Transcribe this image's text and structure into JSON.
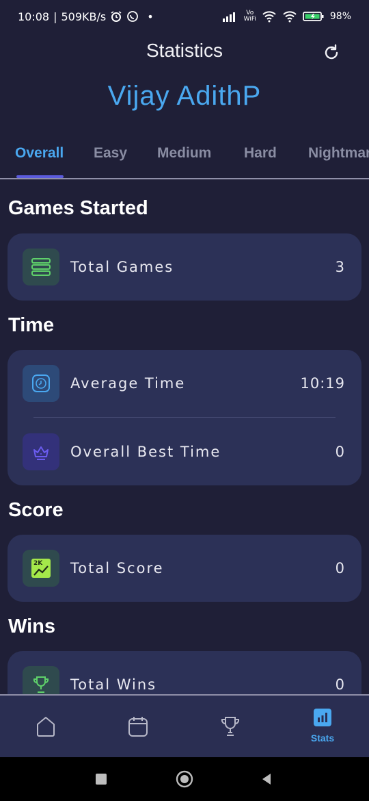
{
  "status_bar": {
    "time": "10:08",
    "network_speed": "509KB/s",
    "battery": "98%",
    "icons": [
      "alarm-icon",
      "whatsapp-icon",
      "signal-icon",
      "vowifi-icon",
      "wifi-icon",
      "battery-icon"
    ],
    "vowifi_top": "Vo",
    "vowifi_bottom": "WiFi"
  },
  "header": {
    "title": "Statistics",
    "refresh_icon": "refresh-icon"
  },
  "user": {
    "name": "Vijay AdithP"
  },
  "tabs": [
    {
      "label": "Overall",
      "active": true
    },
    {
      "label": "Easy",
      "active": false
    },
    {
      "label": "Medium",
      "active": false
    },
    {
      "label": "Hard",
      "active": false
    },
    {
      "label": "Nightmar",
      "active": false
    }
  ],
  "sections": {
    "games_started": {
      "title": "Games Started",
      "rows": [
        {
          "label": "Total Games",
          "value": "3",
          "icon": "stack-icon"
        }
      ]
    },
    "time": {
      "title": "Time",
      "rows": [
        {
          "label": "Average Time",
          "value": "10:19",
          "icon": "clock-icon"
        },
        {
          "label": "Overall Best Time",
          "value": "0",
          "icon": "crown-icon"
        }
      ]
    },
    "score": {
      "title": "Score",
      "rows": [
        {
          "label": "Total Score",
          "value": "0",
          "icon": "score-chart-icon"
        }
      ]
    },
    "wins": {
      "title": "Wins",
      "rows": [
        {
          "label": "Total Wins",
          "value": "0",
          "icon": "trophy-icon"
        }
      ]
    }
  },
  "score_icon_text": "2K",
  "bottom_nav": [
    {
      "icon": "home-icon",
      "label": ""
    },
    {
      "icon": "calendar-icon",
      "label": ""
    },
    {
      "icon": "trophy-icon",
      "label": ""
    },
    {
      "icon": "stats-icon",
      "label": "Stats",
      "active": true
    }
  ],
  "colors": {
    "background": "#1f1f37",
    "card": "#2c3157",
    "accent": "#4aa8f0",
    "tab_underline": "#5b5bdc",
    "green_icon": "#5fd16a"
  }
}
